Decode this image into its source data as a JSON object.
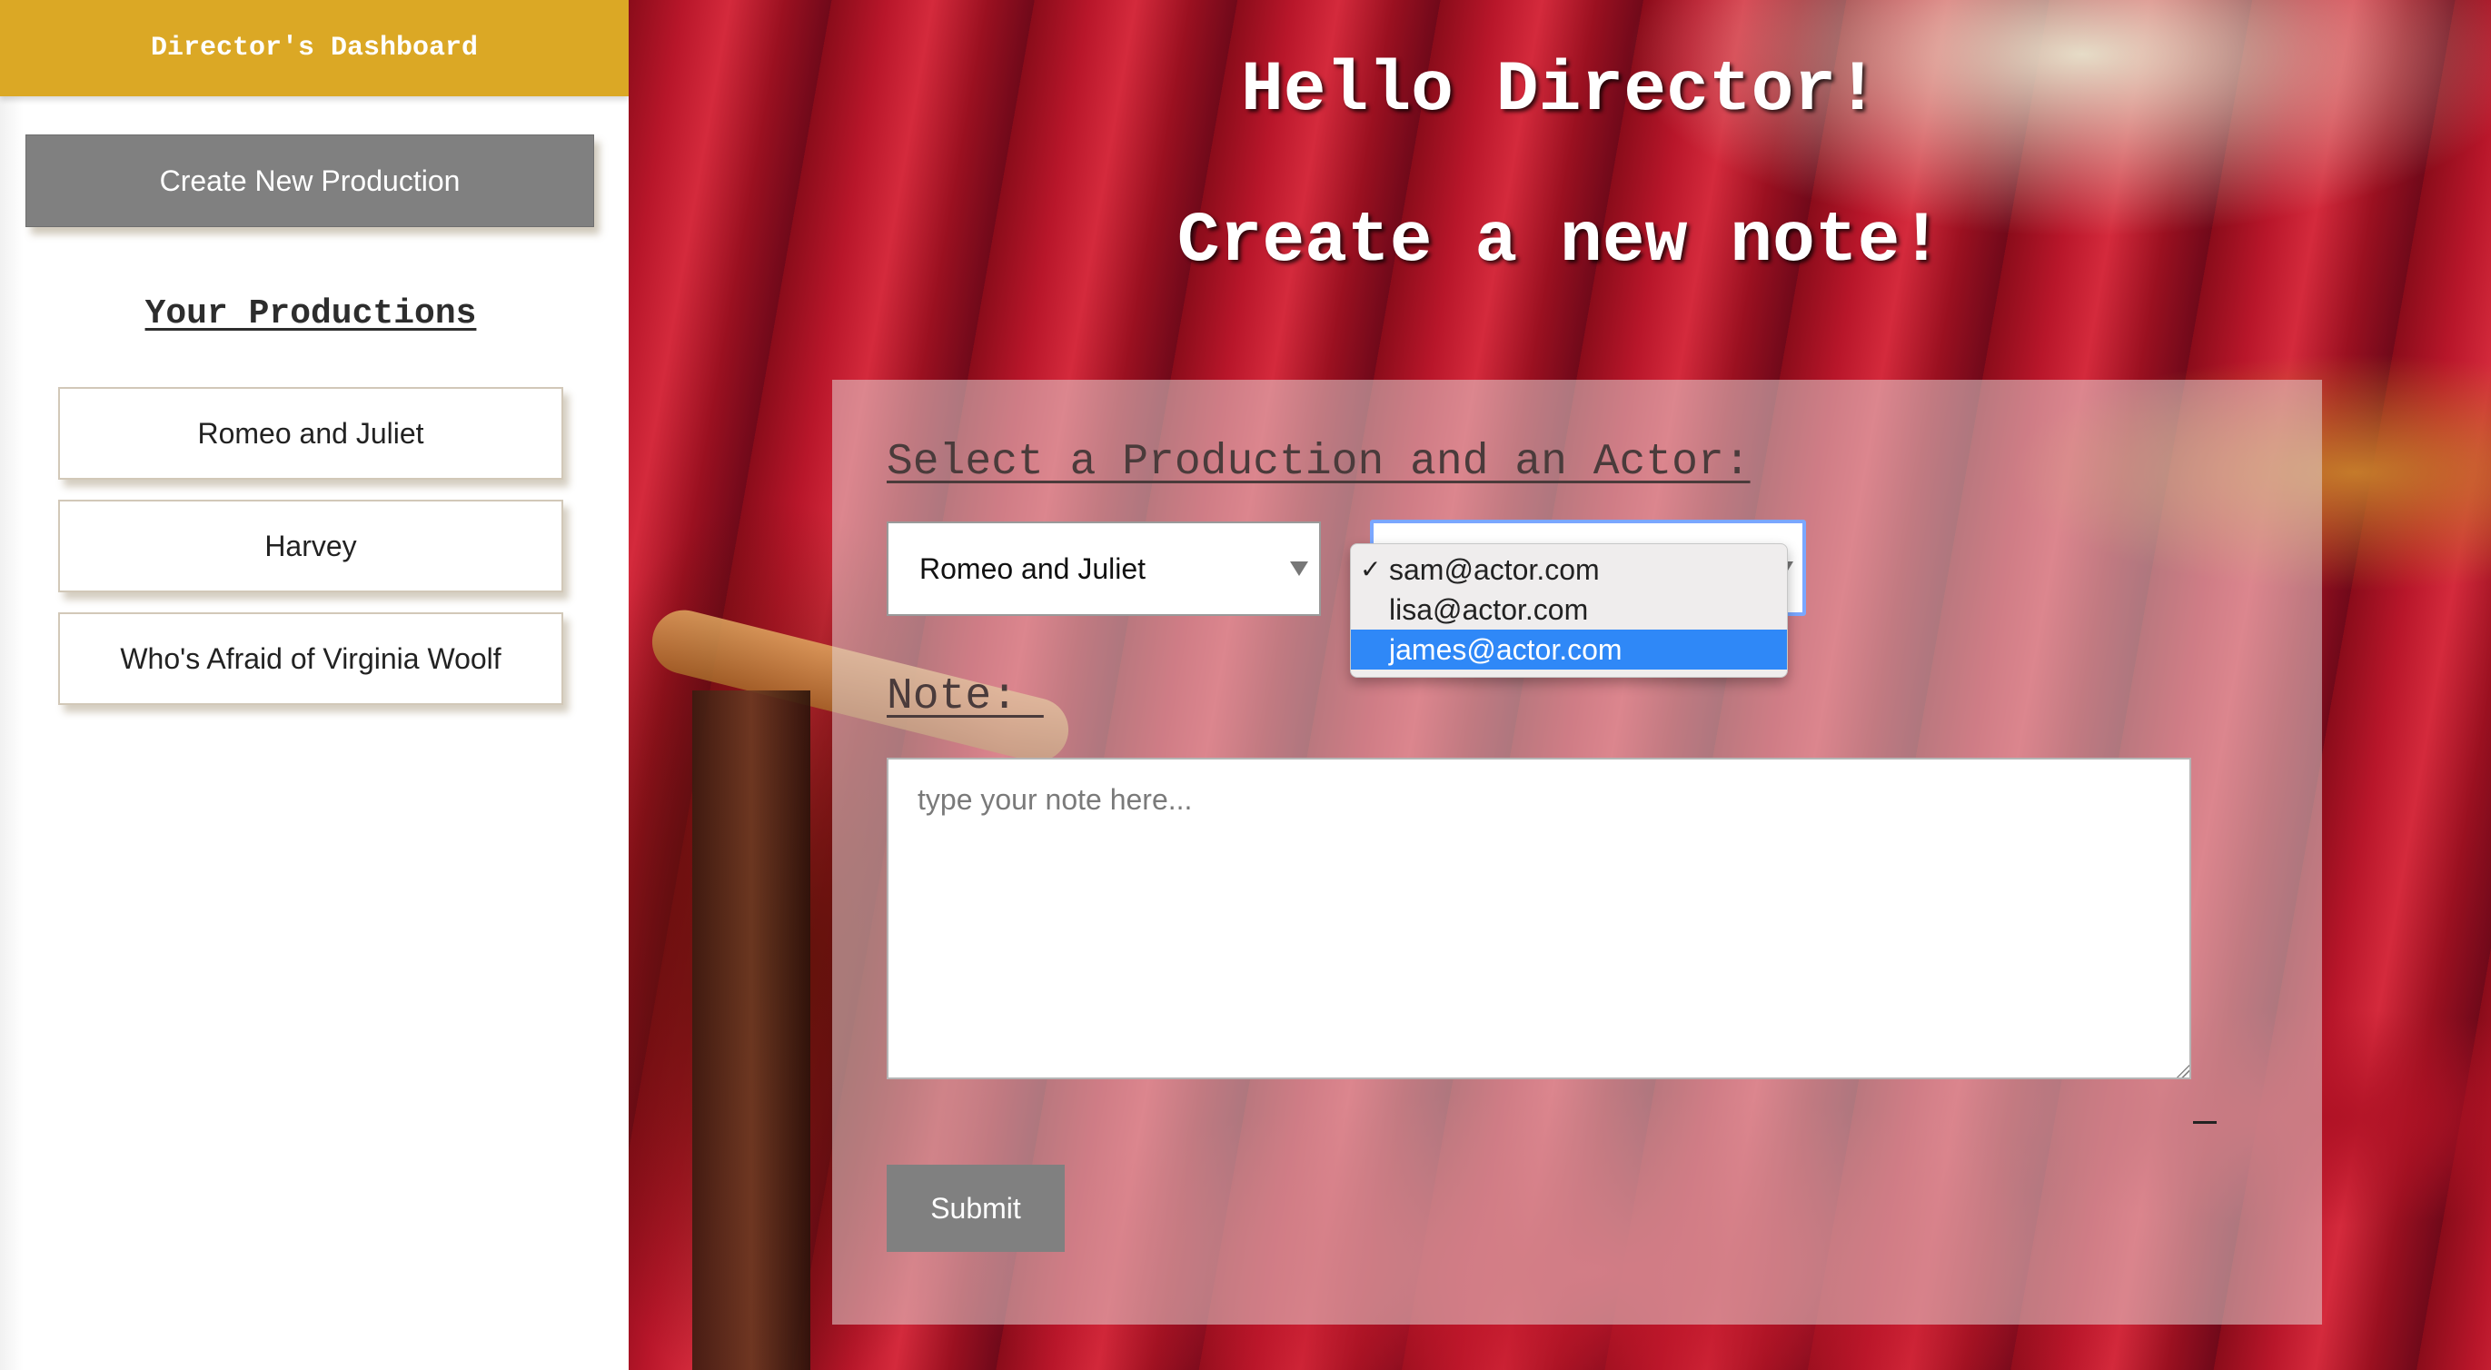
{
  "sidebar": {
    "title": "Director's Dashboard",
    "create_button_label": "Create New Production",
    "productions_heading": "Your Productions",
    "productions": [
      {
        "label": "Romeo and Juliet"
      },
      {
        "label": "Harvey"
      },
      {
        "label": "Who's Afraid of Virginia Woolf"
      }
    ]
  },
  "main": {
    "greeting": "Hello Director!",
    "subtitle": "Create a new note!"
  },
  "form": {
    "select_label": "Select a Production and an Actor:",
    "production_select_value": "Romeo and Juliet",
    "actor_options": [
      {
        "label": "sam@actor.com",
        "checked": true,
        "highlighted": false
      },
      {
        "label": "lisa@actor.com",
        "checked": false,
        "highlighted": false
      },
      {
        "label": "james@actor.com",
        "checked": false,
        "highlighted": true
      }
    ],
    "check_glyph": "✓",
    "note_label": "Note: ",
    "note_placeholder": "type your note here...",
    "submit_label": "Submit"
  },
  "colors": {
    "sidebar_header_bg": "#dba825",
    "button_gray": "#808080",
    "dropdown_highlight": "#2f88f7",
    "select_focus_ring": "#7aa7ff"
  },
  "icons": {
    "select_arrow": "triangle-down",
    "check": "checkmark",
    "resize_grip": "resize-grip"
  }
}
